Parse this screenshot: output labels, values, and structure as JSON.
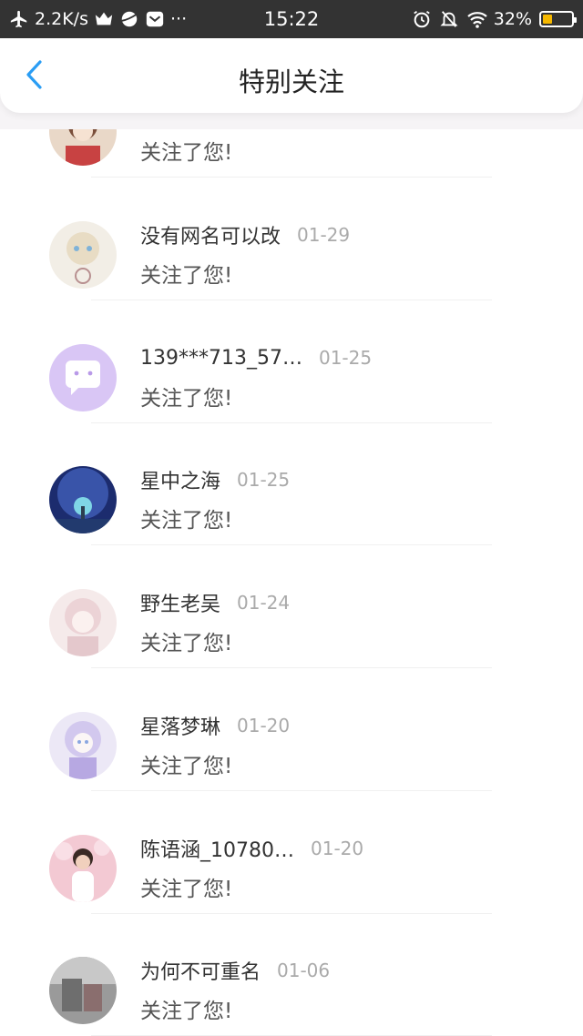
{
  "status_bar": {
    "speed": "2.2K/s",
    "dots": "···",
    "time": "15:22",
    "battery_pct": "32%",
    "battery_level": 0.32,
    "colors": {
      "bar": "#333333",
      "battery": "#f5b800"
    }
  },
  "header": {
    "title": "特别关注",
    "back_icon": "chevron-left-icon",
    "accent": "#2a9df4"
  },
  "items": [
    {
      "name": "",
      "date": "",
      "message": "关注了您!",
      "avatar": "anime-girl"
    },
    {
      "name": "没有网名可以改",
      "date": "01-29",
      "message": "关注了您!",
      "avatar": "anime-pastel"
    },
    {
      "name": "139***713_57…",
      "date": "01-25",
      "message": "关注了您!",
      "avatar": "default-chat"
    },
    {
      "name": "星中之海",
      "date": "01-25",
      "message": "关注了您!",
      "avatar": "galaxy-tree"
    },
    {
      "name": "野生老吴",
      "date": "01-24",
      "message": "关注了您!",
      "avatar": "anime-pink"
    },
    {
      "name": "星落梦琳",
      "date": "01-20",
      "message": "关注了您!",
      "avatar": "anime-lilac"
    },
    {
      "name": "陈语涵_10780…",
      "date": "01-20",
      "message": "关注了您!",
      "avatar": "girl-photo"
    },
    {
      "name": "为何不可重名",
      "date": "01-06",
      "message": "关注了您!",
      "avatar": "photo-grey"
    }
  ]
}
